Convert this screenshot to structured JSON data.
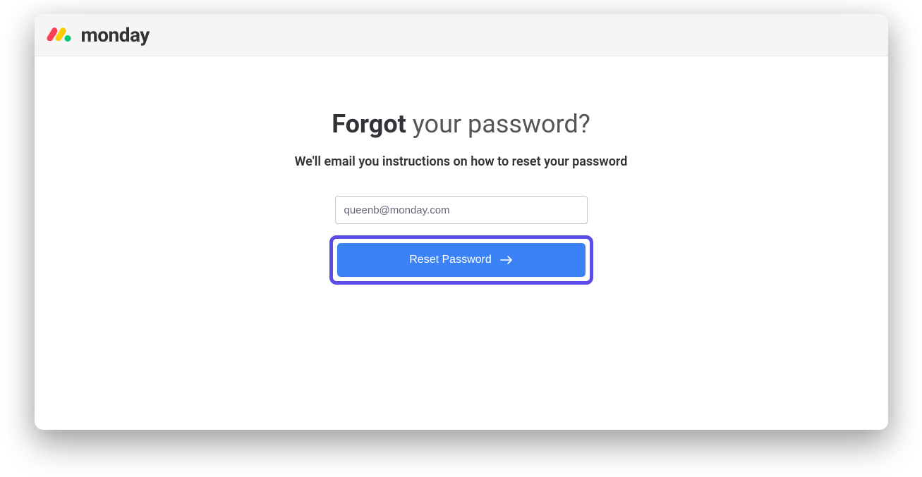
{
  "header": {
    "brand": "monday"
  },
  "main": {
    "heading_bold": "Forgot",
    "heading_rest": " your password?",
    "subheading": "We'll email you instructions on how to reset your password",
    "email_value": "queenb@monday.com",
    "email_placeholder": "",
    "reset_button_label": "Reset Password"
  },
  "colors": {
    "highlight_border": "#5b4ee6",
    "button_bg": "#3b82f6"
  }
}
